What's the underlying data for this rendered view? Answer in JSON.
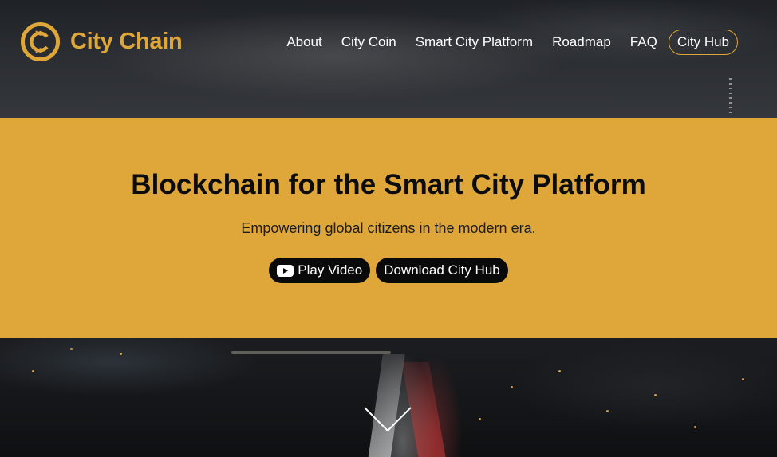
{
  "brand": {
    "name": "City Chain",
    "accent_color": "#dfa739",
    "logo_icon": "city-chain-logo-icon"
  },
  "nav": {
    "items": [
      {
        "label": "About"
      },
      {
        "label": "City Coin"
      },
      {
        "label": "Smart City Platform"
      },
      {
        "label": "Roadmap"
      },
      {
        "label": "FAQ"
      }
    ],
    "cta_label": "City Hub"
  },
  "hero": {
    "title": "Blockchain for the Smart City Platform",
    "subtitle": "Empowering global citizens in the modern era.",
    "play_video_label": "Play Video",
    "play_video_icon": "youtube-play-icon",
    "download_label": "Download City Hub",
    "background_color": "#dfa739"
  },
  "scroll_indicator": {
    "icon": "chevron-down-icon"
  }
}
